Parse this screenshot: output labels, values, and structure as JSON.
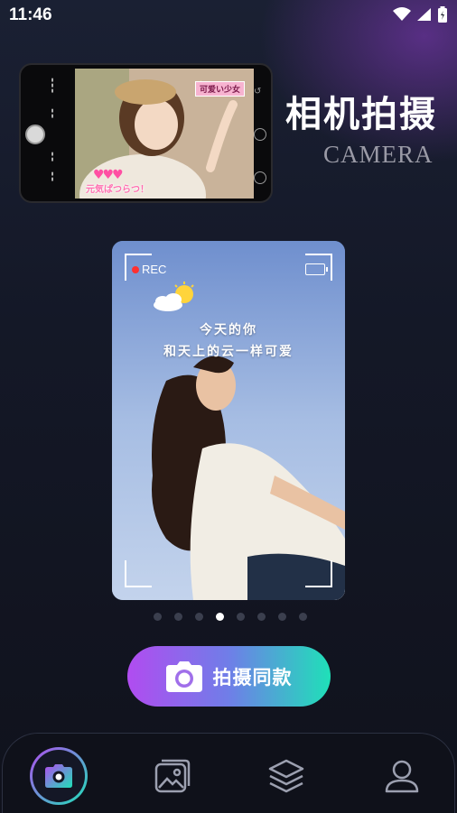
{
  "status_bar": {
    "time": "11:46",
    "icons": [
      "wifi-icon",
      "signal-icon",
      "battery-icon"
    ]
  },
  "hero": {
    "title_cn": "相机拍摄",
    "title_en": "CAMERA",
    "sticker_top": "可爱い少女",
    "sticker_bottom": "元気ぱつらつ！"
  },
  "card": {
    "rec_label": "REC",
    "caption_line1": "今天的你",
    "caption_line2": "和天上的云一样可爱"
  },
  "carousel": {
    "count": 8,
    "active_index": 3
  },
  "cta": {
    "label": "拍摄同款"
  },
  "bottom_nav": {
    "items": [
      {
        "name": "camera",
        "icon": "camera-icon",
        "active": true
      },
      {
        "name": "gallery",
        "icon": "gallery-icon",
        "active": false
      },
      {
        "name": "layers",
        "icon": "layers-icon",
        "active": false
      },
      {
        "name": "profile",
        "icon": "profile-icon",
        "active": false
      }
    ]
  },
  "colors": {
    "background": "#141725",
    "accent_start": "#b14cf0",
    "accent_end": "#1fe0b8",
    "dot_active": "#ffffff",
    "dot_inactive": "#3b3f4e"
  }
}
